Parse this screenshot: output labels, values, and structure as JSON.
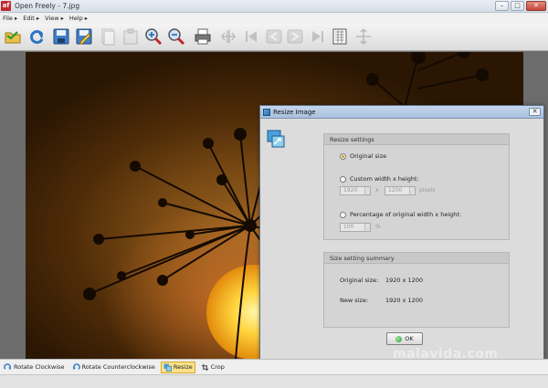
{
  "window": {
    "app_icon": "af",
    "title": "Open Freely - 7.jpg",
    "controls": {
      "minimize": "–",
      "maximize": "□",
      "close": "✕"
    }
  },
  "menu": [
    {
      "label": "File ▸"
    },
    {
      "label": "Edit ▸"
    },
    {
      "label": "View ▸"
    },
    {
      "label": "Help ▸"
    }
  ],
  "toolbar": {
    "icons": [
      "open-folder-icon",
      "refresh-icon",
      "save-icon",
      "edit-save-icon",
      "copy-icon",
      "paste-icon",
      "zoom-in-icon",
      "zoom-out-icon",
      "print-icon",
      "fit-icon",
      "first-icon",
      "previous-icon",
      "next-icon",
      "last-icon",
      "thumbnails-icon",
      "fullscreen-icon"
    ]
  },
  "dialog": {
    "title": "Resize Image",
    "close": "✕",
    "resize_settings": {
      "header": "Resize settings",
      "original_size": "Original size",
      "custom": "Custom width x height:",
      "width_value": "1920",
      "x_label": "x",
      "height_value": "1200",
      "pixels_unit": "pixels",
      "percentage": "Percentage of original width x height:",
      "percent_value": "100",
      "percent_unit": "%"
    },
    "summary": {
      "header": "Size setting summary",
      "original_label": "Original size:",
      "original_value": "1920 x 1200",
      "new_label": "New size:",
      "new_value": "1920 x 1200"
    },
    "ok_label": "OK"
  },
  "bottom_bar": {
    "rotate_cw": "Rotate Clockwise",
    "rotate_ccw": "Rotate Counterclockwise",
    "resize": "Resize",
    "crop": "Crop"
  },
  "watermark": "malavida.com"
}
